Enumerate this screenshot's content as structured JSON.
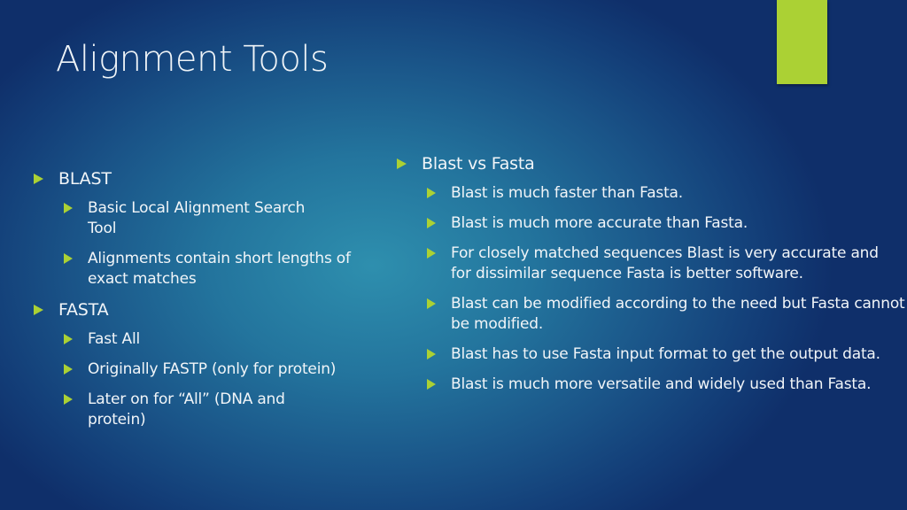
{
  "slide": {
    "title": "Alignment Tools",
    "accent_color": "#abd134",
    "left_column": [
      {
        "level": 1,
        "text": "BLAST"
      },
      {
        "level": 2,
        "text": "Basic Local Alignment Search Tool"
      },
      {
        "level": 2,
        "text": "Alignments contain short lengths of exact matches"
      },
      {
        "level": 1,
        "text": "FASTA"
      },
      {
        "level": 2,
        "text": "Fast All"
      },
      {
        "level": 2,
        "text": "Originally FASTP (only for protein)"
      },
      {
        "level": 2,
        "text": "Later on for “All” (DNA and protein)"
      }
    ],
    "right_column": [
      {
        "level": 1,
        "text": "Blast vs Fasta"
      },
      {
        "level": 2,
        "text": "Blast is much faster than Fasta."
      },
      {
        "level": 2,
        "text": "Blast is much more accurate than Fasta."
      },
      {
        "level": 2,
        "text": "For closely matched sequences Blast is very accurate and for dissimilar sequence Fasta is better software."
      },
      {
        "level": 2,
        "text": "Blast can be modified according to the need but Fasta cannot be modified."
      },
      {
        "level": 2,
        "text": "Blast has to use Fasta input format to get the output data."
      },
      {
        "level": 2,
        "text": "Blast is much more versatile and widely used than Fasta."
      }
    ]
  }
}
